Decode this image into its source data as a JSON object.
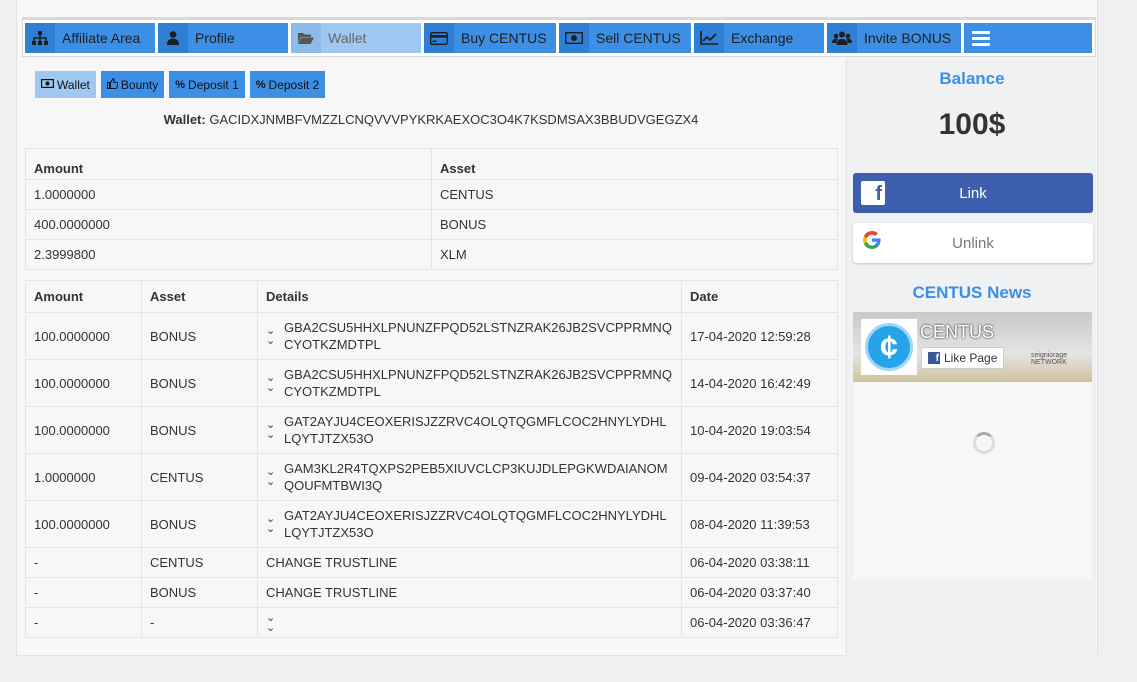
{
  "nav": {
    "items": [
      {
        "label": "Affiliate Area",
        "icon": "sitemap-icon"
      },
      {
        "label": "Profile",
        "icon": "user-icon"
      },
      {
        "label": "Wallet",
        "icon": "folder-open-icon",
        "active": true
      },
      {
        "label": "Buy CENTUS",
        "icon": "credit-card-icon"
      },
      {
        "label": "Sell CENTUS",
        "icon": "money-icon"
      },
      {
        "label": "Exchange",
        "icon": "line-chart-icon"
      },
      {
        "label": "Invite BONUS",
        "icon": "users-icon"
      }
    ],
    "menu_icon": "hamburger-icon"
  },
  "subtabs": [
    {
      "label": "Wallet",
      "icon": "money-icon",
      "active": true
    },
    {
      "label": "Bounty",
      "icon": "thumbs-up-icon"
    },
    {
      "label": "Deposit 1",
      "icon": "percent-icon"
    },
    {
      "label": "Deposit 2",
      "icon": "percent-icon"
    }
  ],
  "wallet": {
    "label": "Wallet:",
    "address": "GACIDXJNMBFVMZZLCNQVVVPYKRKAEXOC3O4K7KSDMSAX3BBUDVGEGZX4"
  },
  "balances": {
    "headers": [
      "Amount",
      "Asset"
    ],
    "rows": [
      [
        "1.0000000",
        "CENTUS"
      ],
      [
        "400.0000000",
        "BONUS"
      ],
      [
        "2.3999800",
        "XLM"
      ]
    ]
  },
  "transactions": {
    "headers": [
      "Amount",
      "Asset",
      "Details",
      "Date"
    ],
    "rows": [
      [
        "100.0000000",
        "BONUS",
        "GBA2CSU5HHXLPNUNZFPQD52LSTNZRAK26JB2SVCPPRMNQCYOTKZMDTPL",
        "17-04-2020 12:59:28"
      ],
      [
        "100.0000000",
        "BONUS",
        "GBA2CSU5HHXLPNUNZFPQD52LSTNZRAK26JB2SVCPPRMNQCYOTKZMDTPL",
        "14-04-2020 16:42:49"
      ],
      [
        "100.0000000",
        "BONUS",
        "GAT2AYJU4CEOXERISJZZRVC4OLQTQGMFLCOC2HNYLYDHLLQYTJTZX53O",
        "10-04-2020 19:03:54"
      ],
      [
        "1.0000000",
        "CENTUS",
        "GAM3KL2R4TQXPS2PEB5XIUVCLCP3KUJDLEPGKWDAIANOMQOUFMTBWI3Q",
        "09-04-2020 03:54:37"
      ],
      [
        "100.0000000",
        "BONUS",
        "GAT2AYJU4CEOXERISJZZRVC4OLQTQGMFLCOC2HNYLYDHLLQYTJTZX53O",
        "08-04-2020 11:39:53"
      ],
      [
        "-",
        "CENTUS",
        "CHANGE TRUSTLINE",
        "06-04-2020 03:38:11"
      ],
      [
        "-",
        "BONUS",
        "CHANGE TRUSTLINE",
        "06-04-2020 03:37:40"
      ],
      [
        "-",
        "-",
        "",
        "06-04-2020 03:36:47"
      ]
    ]
  },
  "sidebar": {
    "balance_title": "Balance",
    "balance_value": "100$",
    "facebook_button": "Link",
    "google_button": "Unlink",
    "news_title": "CENTUS News",
    "fb_page_name": "CENTUS",
    "fb_like_label": "Like Page",
    "fb_cover_text": [
      "seigniorage",
      "NETWORK"
    ]
  },
  "colors": {
    "accent": "#3d8fe6",
    "active_tab": "#9fc9f2",
    "facebook": "#3d5fae",
    "incoming_chevron": "#1b8a1b"
  }
}
